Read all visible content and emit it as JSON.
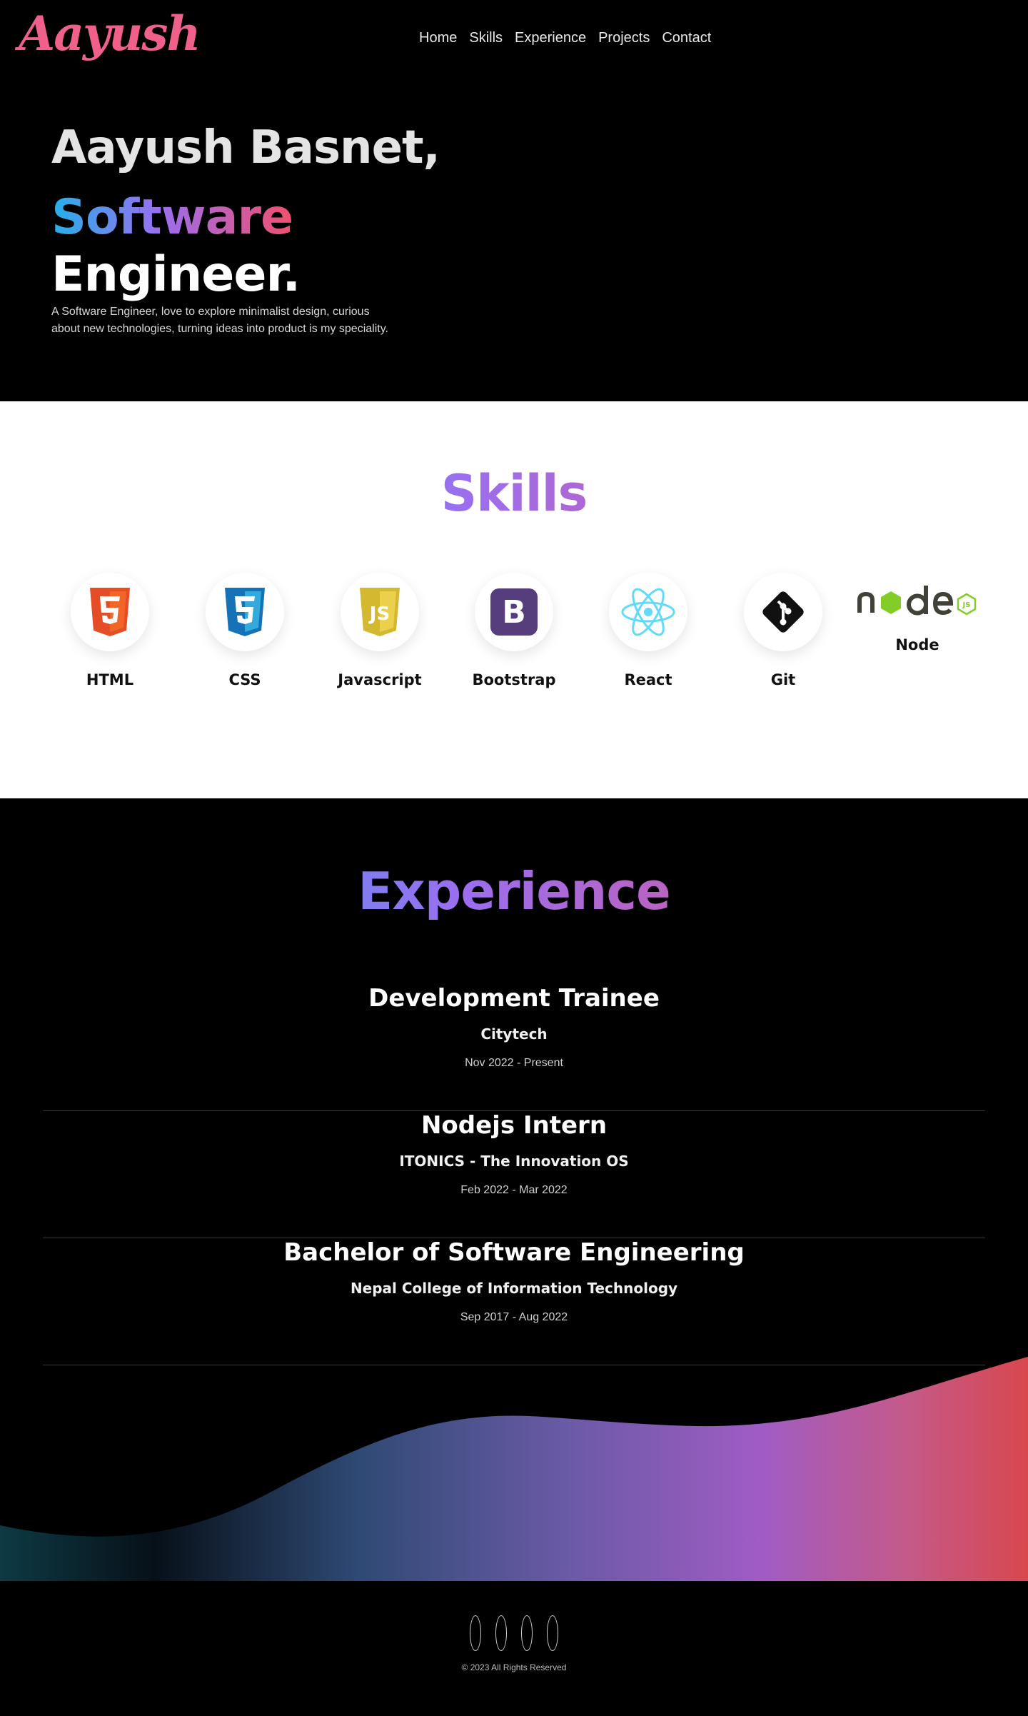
{
  "nav": {
    "logo": "Aayush",
    "links": [
      "Home",
      "Skills",
      "Experience",
      "Projects",
      "Contact"
    ]
  },
  "hero": {
    "name": "Aayush Basnet,",
    "role_highlight": "Software",
    "role_rest": "Engineer.",
    "description": "A Software Engineer, love to explore minimalist design, curious about new technologies, turning ideas into product is my speciality."
  },
  "skills": {
    "title": "Skills",
    "items": [
      {
        "label": "HTML",
        "icon": "html5-icon"
      },
      {
        "label": "CSS",
        "icon": "css3-icon"
      },
      {
        "label": "Javascript",
        "icon": "js-icon"
      },
      {
        "label": "Bootstrap",
        "icon": "bootstrap-icon"
      },
      {
        "label": "React",
        "icon": "react-icon"
      },
      {
        "label": "Git",
        "icon": "git-icon"
      },
      {
        "label": "Node",
        "icon": "node-icon"
      }
    ]
  },
  "experience": {
    "title": "Experience",
    "items": [
      {
        "title": "Development Trainee",
        "org": "Citytech",
        "date": "Nov 2022 - Present"
      },
      {
        "title": "Nodejs Intern",
        "org": "ITONICS - The Innovation OS",
        "date": "Feb 2022 - Mar 2022"
      },
      {
        "title": "Bachelor of Software Engineering",
        "org": "Nepal College of Information Technology",
        "date": "Sep 2017 - Aug 2022"
      }
    ]
  },
  "footer": {
    "copyright": "© 2023 All Rights Reserved"
  },
  "colors": {
    "logo": "#f0608a",
    "gradient_start": "#25b0ea",
    "gradient_mid": "#9b6ef0",
    "gradient_end": "#f0506e"
  }
}
